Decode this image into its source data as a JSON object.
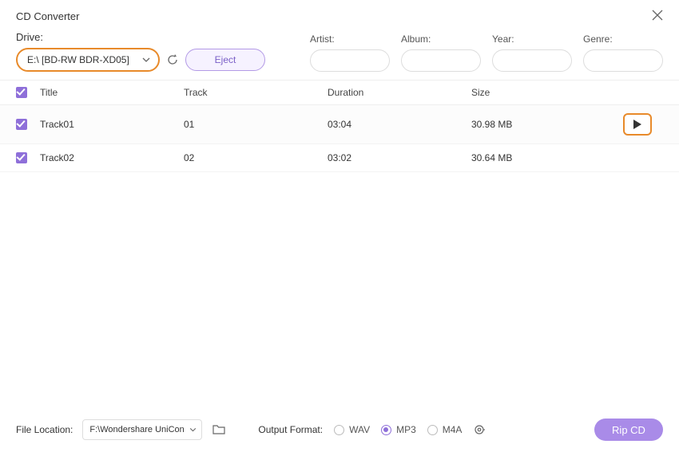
{
  "window": {
    "title": "CD Converter"
  },
  "drive": {
    "label": "Drive:",
    "selected": "E:\\ [BD-RW   BDR-XD05]",
    "eject_label": "Eject"
  },
  "meta": {
    "artist_label": "Artist:",
    "album_label": "Album:",
    "year_label": "Year:",
    "genre_label": "Genre:",
    "artist": "",
    "album": "",
    "year": "",
    "genre": ""
  },
  "columns": {
    "title": "Title",
    "track": "Track",
    "duration": "Duration",
    "size": "Size"
  },
  "tracks": [
    {
      "checked": true,
      "title": "Track01",
      "track": "01",
      "duration": "03:04",
      "size": "30.98 MB"
    },
    {
      "checked": true,
      "title": "Track02",
      "track": "02",
      "duration": "03:02",
      "size": "30.64 MB"
    }
  ],
  "footer": {
    "file_location_label": "File Location:",
    "file_location": "F:\\Wondershare UniConverter",
    "output_format_label": "Output Format:",
    "formats": [
      "WAV",
      "MP3",
      "M4A"
    ],
    "selected_format": "MP3",
    "rip_label": "Rip CD"
  }
}
